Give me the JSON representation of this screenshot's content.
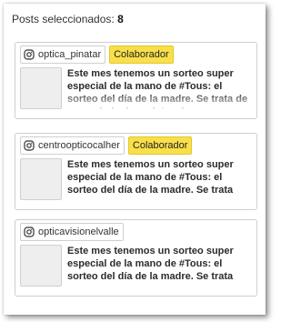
{
  "header": {
    "label": "Posts seleccionados:",
    "count": "8"
  },
  "badge_label": "Colaborador",
  "posts": [
    {
      "account": "optica_pinatar",
      "collaborator": true,
      "text": "Este mes tenemos un sorteo super especial de la mano de #Tous: el sorteo del día de la madre. Se trata de un pack de dos relojes de acero"
    },
    {
      "account": "centroopticocalher",
      "collaborator": true,
      "text": "Este mes tenemos un sorteo super especial de la mano de #Tous: el sorteo del día de la madre. Se trata"
    },
    {
      "account": "opticavisionelvalle",
      "collaborator": false,
      "text": "Este mes tenemos un sorteo super especial de la mano de #Tous: el sorteo del día de la madre. Se trata"
    }
  ],
  "colors": {
    "badge": "#f9e04a",
    "thumb": "#eeeeee",
    "border": "#cfcfcf"
  },
  "icons": {
    "account": "instagram-icon"
  }
}
